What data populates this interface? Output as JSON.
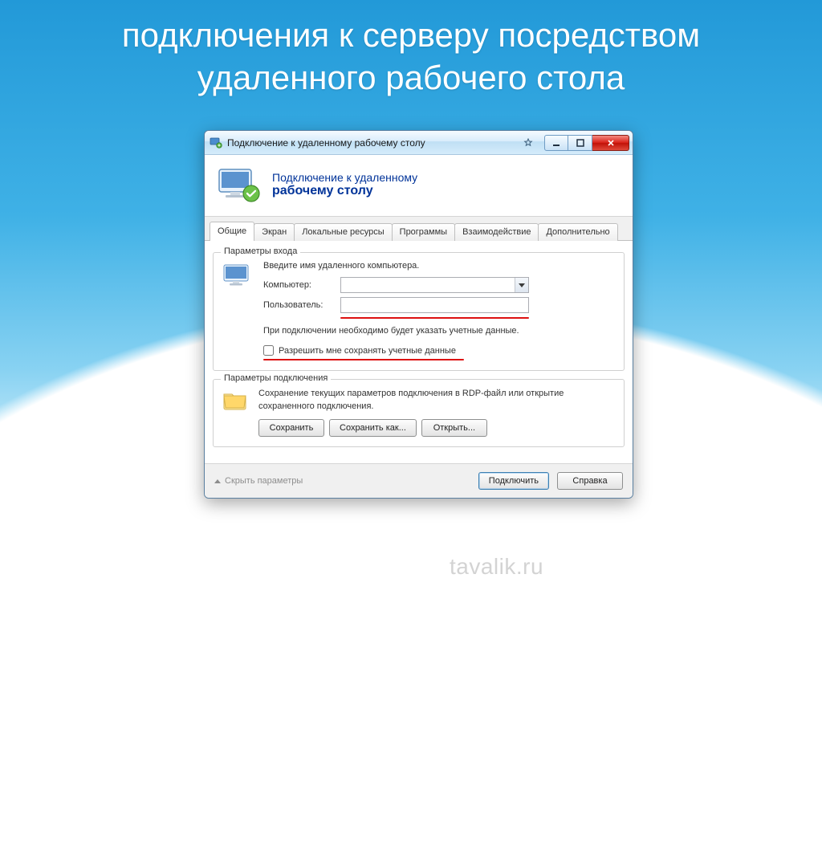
{
  "slide": {
    "title": "подключения к серверу посредством удаленного рабочего стола"
  },
  "window": {
    "title": "Подключение к удаленному рабочему столу",
    "header_line1": "Подключение к удаленному",
    "header_line2": "рабочему столу"
  },
  "tabs": [
    {
      "label": "Общие",
      "active": true
    },
    {
      "label": "Экран",
      "active": false
    },
    {
      "label": "Локальные ресурсы",
      "active": false
    },
    {
      "label": "Программы",
      "active": false
    },
    {
      "label": "Взаимодействие",
      "active": false
    },
    {
      "label": "Дополнительно",
      "active": false
    }
  ],
  "login_group": {
    "legend": "Параметры входа",
    "instruction": "Введите имя удаленного компьютера.",
    "computer_label": "Компьютер:",
    "computer_value": "",
    "user_label": "Пользователь:",
    "user_value": "",
    "note": "При подключении необходимо будет указать учетные данные.",
    "checkbox_label": "Разрешить мне сохранять учетные данные"
  },
  "conn_group": {
    "legend": "Параметры подключения",
    "desc": "Сохранение текущих параметров подключения в RDP-файл или открытие сохраненного подключения.",
    "save_btn": "Сохранить",
    "save_as_btn": "Сохранить как...",
    "open_btn": "Открыть..."
  },
  "footer": {
    "hide_link": "Скрыть параметры",
    "connect_btn": "Подключить",
    "help_btn": "Справка"
  },
  "watermark": "tavalik.ru"
}
